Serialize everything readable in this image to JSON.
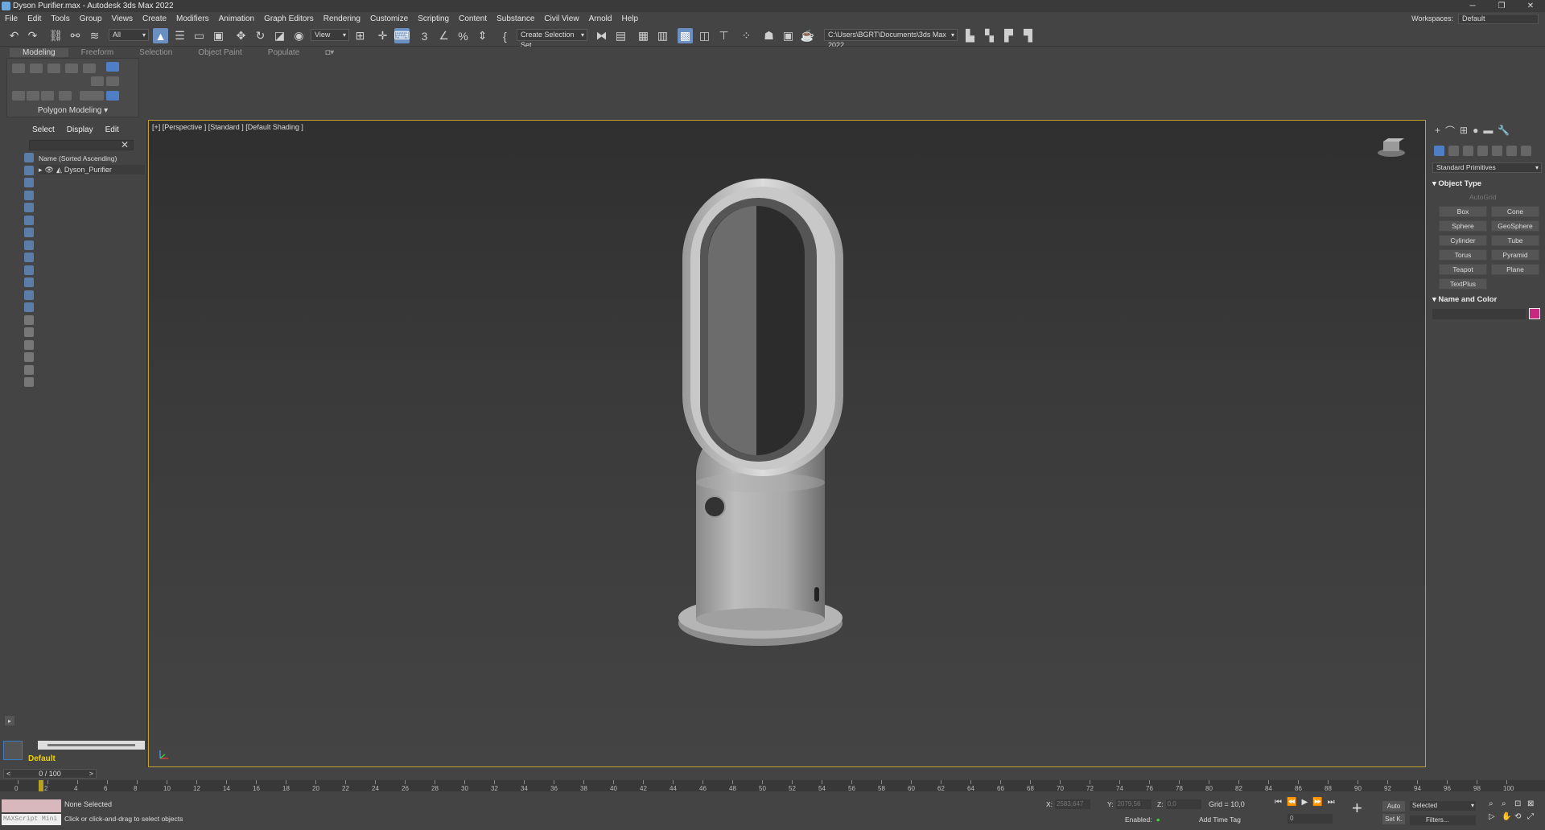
{
  "window": {
    "title": "Dyson Purifier.max - Autodesk 3ds Max 2022",
    "buttons": [
      "─",
      "❐",
      "✕"
    ]
  },
  "menu": {
    "items": [
      "File",
      "Edit",
      "Tools",
      "Group",
      "Views",
      "Create",
      "Modifiers",
      "Animation",
      "Graph Editors",
      "Rendering",
      "Customize",
      "Scripting",
      "Content",
      "Substance",
      "Civil View",
      "Arnold",
      "Help"
    ],
    "workspaces_label": "Workspaces:",
    "workspace_value": "Default"
  },
  "toolbar": {
    "filter_value": "All",
    "refcoord_value": "View",
    "selection_set_value": "Create Selection Set",
    "path_value": "C:\\Users\\BGRT\\Documents\\3ds Max 2022"
  },
  "ribbon": {
    "tabs": [
      "Modeling",
      "Freeform",
      "Selection",
      "Object Paint",
      "Populate"
    ],
    "panel_label": "Polygon Modeling"
  },
  "scene_explorer": {
    "tabs": [
      "Select",
      "Display",
      "Edit"
    ],
    "header": "Name (Sorted Ascending)",
    "rows": [
      "Dyson_Purifier"
    ],
    "layer_name": "Default"
  },
  "viewport": {
    "label": "[+] [Perspective ] [Standard ] [Default Shading ]"
  },
  "command_panel": {
    "dropdown": "Standard Primitives",
    "object_type_title": "Object Type",
    "autogrid": "AutoGrid",
    "primitives": [
      "Box",
      "Cone",
      "Sphere",
      "GeoSphere",
      "Cylinder",
      "Tube",
      "Torus",
      "Pyramid",
      "Teapot",
      "Plane",
      "TextPlus"
    ],
    "name_color_title": "Name and Color",
    "color": "#c8287d"
  },
  "timeline": {
    "slider": "0 / 100",
    "ticks": [
      "0",
      "2",
      "4",
      "6",
      "8",
      "10",
      "12",
      "14",
      "16",
      "18",
      "20",
      "22",
      "24",
      "26",
      "28",
      "30",
      "32",
      "34",
      "36",
      "38",
      "40",
      "42",
      "44",
      "46",
      "48",
      "50",
      "52",
      "54",
      "56",
      "58",
      "60",
      "62",
      "64",
      "66",
      "68",
      "70",
      "72",
      "74",
      "76",
      "78",
      "80",
      "82",
      "84",
      "86",
      "88",
      "90",
      "92",
      "94",
      "96",
      "98",
      "100"
    ]
  },
  "status": {
    "maxscript_label": "MAXScript Mini",
    "selection": "None Selected",
    "prompt": "Click or click-and-drag to select objects",
    "x_label": "X:",
    "x_value": "2583,647",
    "y_label": "Y:",
    "y_value": "2079,56",
    "z_label": "Z:",
    "z_value": "0,0",
    "grid": "Grid = 10,0",
    "enabled_label": "Enabled:",
    "add_time_tag": "Add Time Tag",
    "auto_label": "Auto",
    "setkey_label": "Set K.",
    "selected_value": "Selected",
    "filters_label": "Filters...",
    "frame_value": "0"
  }
}
